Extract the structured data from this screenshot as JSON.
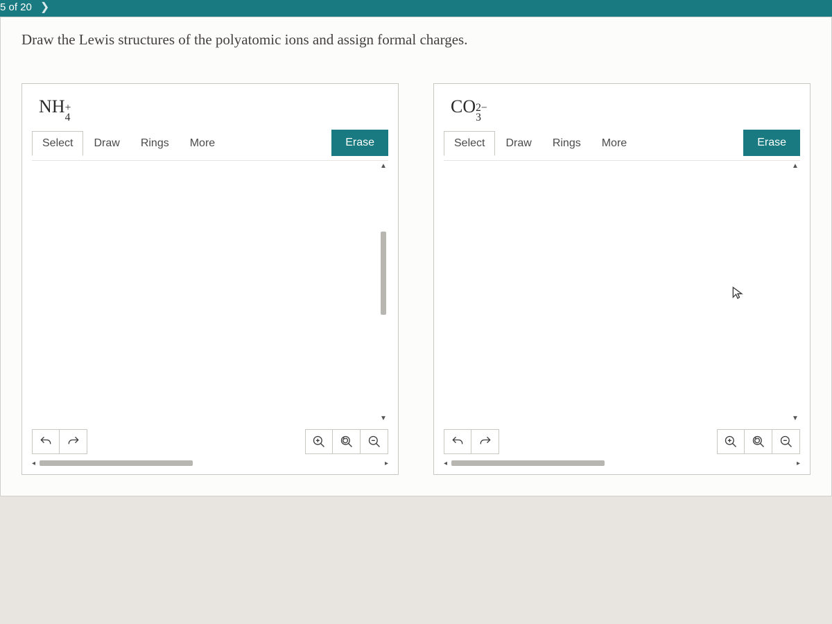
{
  "nav": {
    "counter": "5 of 20"
  },
  "prompt": "Draw the Lewis structures of the polyatomic ions and assign formal charges.",
  "panel1": {
    "formula_base": "NH",
    "formula_sub": "4",
    "formula_sup": "+",
    "toolbar": {
      "select": "Select",
      "draw": "Draw",
      "rings": "Rings",
      "more": "More",
      "erase": "Erase"
    }
  },
  "panel2": {
    "formula_base": "CO",
    "formula_sub": "3",
    "formula_sup": "2−",
    "toolbar": {
      "select": "Select",
      "draw": "Draw",
      "rings": "Rings",
      "more": "More",
      "erase": "Erase"
    }
  }
}
